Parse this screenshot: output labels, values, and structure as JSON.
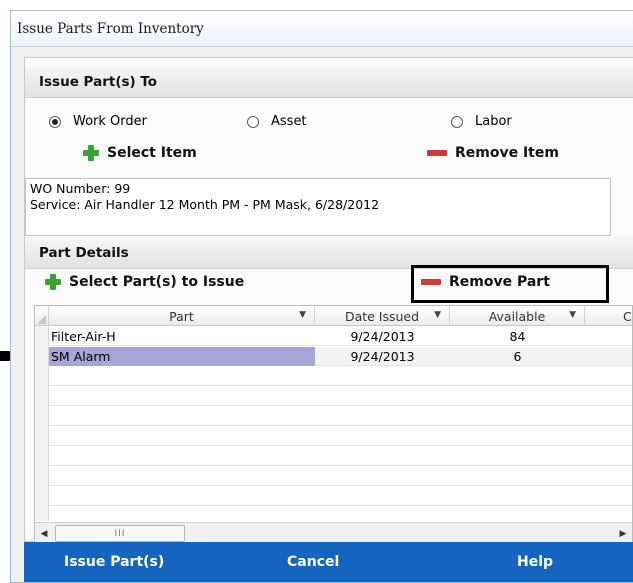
{
  "window": {
    "title": "Issue Parts From Inventory"
  },
  "issue_to": {
    "header": "Issue Part(s) To",
    "options": [
      {
        "label": "Work Order",
        "checked": true
      },
      {
        "label": "Asset",
        "checked": false
      },
      {
        "label": "Labor",
        "checked": false
      }
    ],
    "select_item_label": "Select Item",
    "remove_item_label": "Remove Item",
    "wo_number_line": "WO Number:  99",
    "service_line": "Service:  Air Handler 12 Month PM - PM Mask, 6/28/2012"
  },
  "part_details": {
    "header": "Part Details",
    "select_parts_label": "Select Part(s) to Issue",
    "remove_part_label": "Remove Part"
  },
  "grid": {
    "columns": [
      "Part",
      "Date Issued",
      "Available",
      "C"
    ],
    "rows": [
      {
        "part": "Filter-Air-H",
        "date_issued": "9/24/2013",
        "available": "84"
      },
      {
        "part": "SM Alarm",
        "date_issued": "9/24/2013",
        "available": "6"
      }
    ],
    "selected_row_index": 1,
    "scroll_thumb": "III"
  },
  "footer": {
    "issue_label": "Issue Part(s)",
    "cancel_label": "Cancel",
    "help_label": "Help"
  },
  "colors": {
    "footer_bg": "#1565c0",
    "selected_row": "#a9a4d6",
    "plus": "#3aa335",
    "minus": "#d23a3a"
  },
  "icons": [
    "plus-icon",
    "minus-icon",
    "radio-icon",
    "sort-arrow-icon",
    "scroll-left-icon",
    "scroll-right-icon",
    "pointer-arrow-icon"
  ]
}
